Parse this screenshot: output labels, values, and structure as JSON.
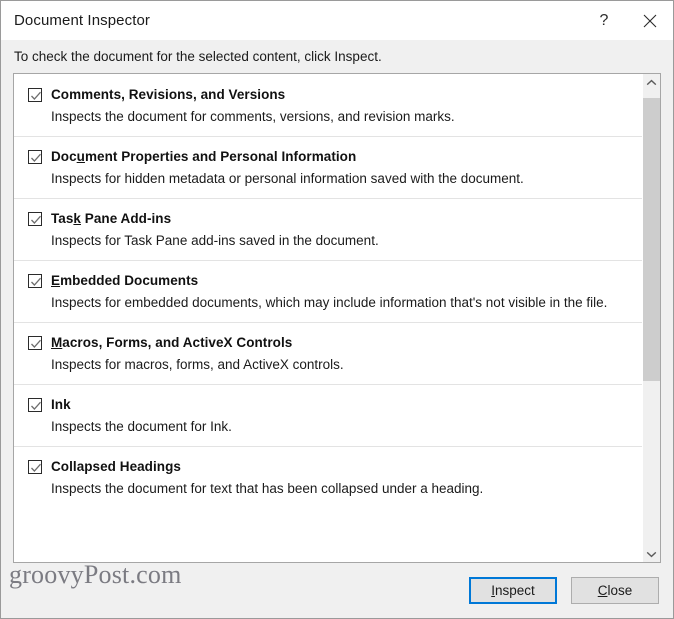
{
  "window": {
    "title": "Document Inspector",
    "help_label": "?",
    "close_label": "×",
    "help_icon": "question-mark-icon",
    "close_icon": "close-x-icon"
  },
  "instruction": "To check the document for the selected content, click Inspect.",
  "list": {
    "items": [
      {
        "checked": true,
        "title_pre": "Comments, Revisions, and Versions",
        "accel": "",
        "title_post": "",
        "title_full": "Comments, Revisions, and Versions",
        "description": "Inspects the document for comments, versions, and revision marks."
      },
      {
        "checked": true,
        "title_pre": "Doc",
        "accel": "u",
        "title_post": "ment Properties and Personal Information",
        "title_full": "Document Properties and Personal Information",
        "description": "Inspects for hidden metadata or personal information saved with the document."
      },
      {
        "checked": true,
        "title_pre": "Tas",
        "accel": "k",
        "title_post": " Pane Add-ins",
        "title_full": "Task Pane Add-ins",
        "description": "Inspects for Task Pane add-ins saved in the document."
      },
      {
        "checked": true,
        "title_pre": "",
        "accel": "E",
        "title_post": "mbedded Documents",
        "title_full": "Embedded Documents",
        "description": "Inspects for embedded documents, which may include information that's not visible in the file."
      },
      {
        "checked": true,
        "title_pre": "",
        "accel": "M",
        "title_post": "acros, Forms, and ActiveX Controls",
        "title_full": "Macros, Forms, and ActiveX Controls",
        "description": "Inspects for macros, forms, and ActiveX controls."
      },
      {
        "checked": true,
        "title_pre": "Ink",
        "accel": "",
        "title_post": "",
        "title_full": "Ink",
        "description": "Inspects the document for Ink."
      },
      {
        "checked": true,
        "title_pre": "Collapsed Headings",
        "accel": "",
        "title_post": "",
        "title_full": "Collapsed Headings",
        "description": "Inspects the document for text that has been collapsed under a heading."
      }
    ],
    "scrollbar": {
      "up_arrow_icon": "chevron-up-icon",
      "down_arrow_icon": "chevron-down-icon"
    }
  },
  "footer": {
    "inspect": {
      "pre": "",
      "accel": "I",
      "post": "nspect",
      "full": "Inspect"
    },
    "close": {
      "pre": "",
      "accel": "C",
      "post": "lose",
      "full": "Close"
    }
  },
  "watermark": "groovyPost.com",
  "colors": {
    "accent": "#0078d7",
    "dialog_bg": "#f0f0f0",
    "list_bg": "#ffffff",
    "border": "#a6a6a6",
    "separator": "#e3e3e3",
    "scroll_thumb": "#cdcdcd",
    "watermark": "#7b7b82"
  }
}
